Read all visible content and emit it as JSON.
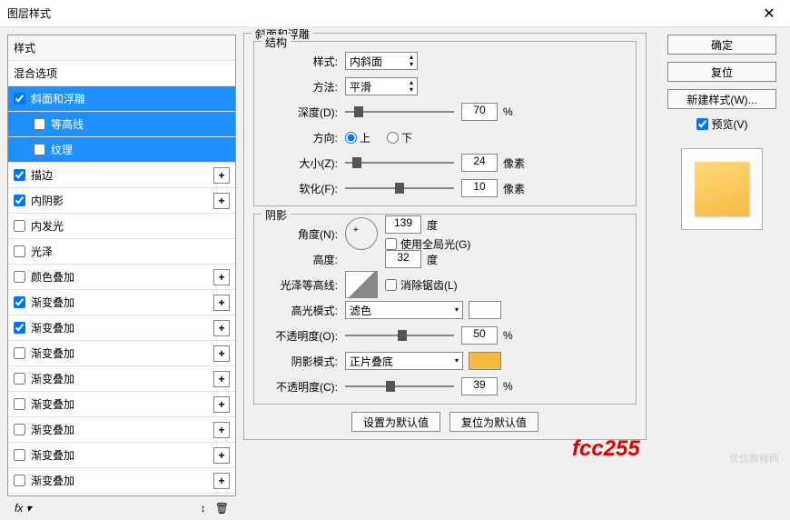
{
  "window": {
    "title": "图层样式"
  },
  "styles": {
    "header": "样式",
    "blend_options": "混合选项",
    "items": [
      {
        "label": "斜面和浮雕",
        "checked": true,
        "selected": true,
        "plus": false
      },
      {
        "label": "等高线",
        "checked": false,
        "selected": true,
        "sub": true
      },
      {
        "label": "纹理",
        "checked": false,
        "selected": true,
        "sub": true
      },
      {
        "label": "描边",
        "checked": true,
        "plus": true
      },
      {
        "label": "内阴影",
        "checked": true,
        "plus": true
      },
      {
        "label": "内发光",
        "checked": false
      },
      {
        "label": "光泽",
        "checked": false
      },
      {
        "label": "颜色叠加",
        "checked": false,
        "plus": true
      },
      {
        "label": "渐变叠加",
        "checked": true,
        "plus": true
      },
      {
        "label": "渐变叠加",
        "checked": true,
        "plus": true
      },
      {
        "label": "渐变叠加",
        "checked": false,
        "plus": true
      },
      {
        "label": "渐变叠加",
        "checked": false,
        "plus": true
      },
      {
        "label": "渐变叠加",
        "checked": false,
        "plus": true
      },
      {
        "label": "渐变叠加",
        "checked": false,
        "plus": true
      },
      {
        "label": "渐变叠加",
        "checked": false,
        "plus": true
      },
      {
        "label": "渐变叠加",
        "checked": false,
        "plus": true
      }
    ]
  },
  "bevel": {
    "group_title": "斜面和浮雕",
    "structure_title": "结构",
    "style_label": "样式:",
    "style_value": "内斜面",
    "technique_label": "方法:",
    "technique_value": "平滑",
    "depth_label": "深度(D):",
    "depth_value": "70",
    "depth_unit": "%",
    "direction_label": "方向:",
    "up": "上",
    "down": "下",
    "size_label": "大小(Z):",
    "size_value": "24",
    "size_unit": "像素",
    "soften_label": "软化(F):",
    "soften_value": "10",
    "soften_unit": "像素"
  },
  "shading": {
    "group_title": "阴影",
    "angle_label": "角度(N):",
    "angle_value": "139",
    "angle_unit": "度",
    "global_light": "使用全局光(G)",
    "altitude_label": "高度:",
    "altitude_value": "32",
    "altitude_unit": "度",
    "gloss_label": "光泽等高线:",
    "antialias": "消除锯齿(L)",
    "highlight_mode_label": "高光模式:",
    "highlight_mode_value": "滤色",
    "highlight_opacity_label": "不透明度(O):",
    "highlight_opacity_value": "50",
    "opacity_unit": "%",
    "shadow_mode_label": "阴影模式:",
    "shadow_mode_value": "正片叠底",
    "shadow_color": "#f5b942",
    "shadow_opacity_label": "不透明度(C):",
    "shadow_opacity_value": "39"
  },
  "buttons": {
    "default_set": "设置为默认值",
    "default_reset": "复位为默认值",
    "ok": "确定",
    "cancel": "复位",
    "new_style": "新建样式(W)...",
    "preview": "预览(V)"
  },
  "annotation": {
    "color_code": "fcc255",
    "watermark": "优优教程网"
  }
}
